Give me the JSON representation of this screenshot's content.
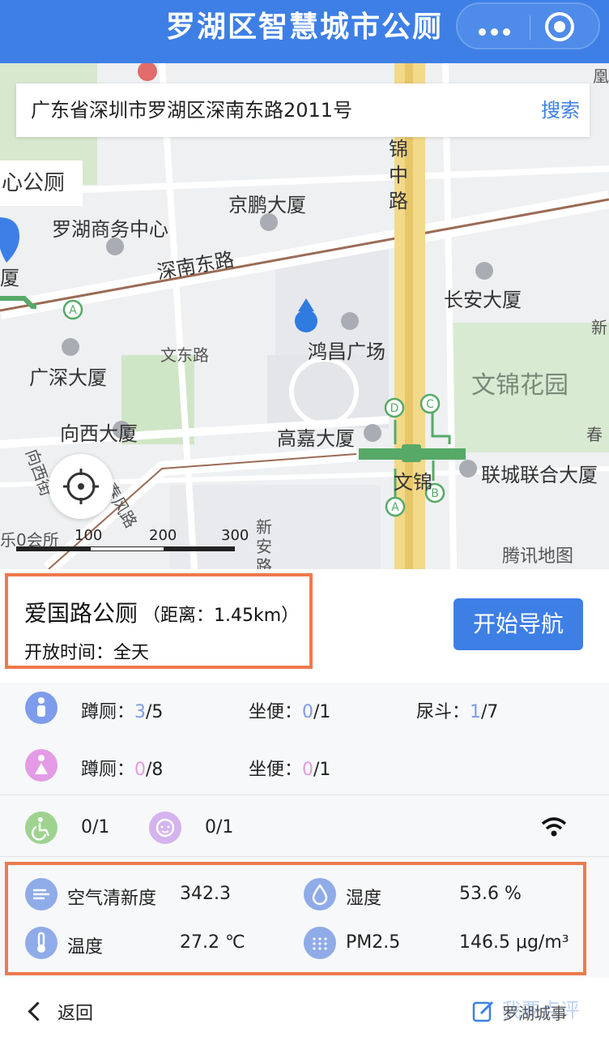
{
  "header": {
    "title": "罗湖区智慧城市公厕"
  },
  "search": {
    "address": "广东省深圳市罗湖区深南东路2011号",
    "button": "搜索"
  },
  "map": {
    "side_label": "心公厕",
    "labels": {
      "jinjin_road": "锦中路",
      "jingpeng": "京鹏大厦",
      "luohu_center": "罗湖商务中心",
      "shennan_road": "深南东路",
      "changan": "长安大厦",
      "hongchang": "鸿昌广场",
      "wendong_road": "文东路",
      "guangshen": "广深大厦",
      "wenjin_garden": "文锦花园",
      "xiangxi": "向西大厦",
      "gaojia": "高嘉大厦",
      "liancheng": "联城联合大厦",
      "wenjin_station": "文锦",
      "chunfeng_road": "春风路",
      "xiangxi_street": "向西街",
      "xin_an": "新安路",
      "toilet_short": "乐0会所",
      "xia": "厦",
      "huang": "凰",
      "xin": "新",
      "chun": "春"
    },
    "scale": [
      "100",
      "200",
      "300"
    ],
    "provider": "腾讯地图"
  },
  "toilet": {
    "name": "爱国路公厕",
    "distance": "（距离：1.45km）",
    "open_label": "开放时间：",
    "open_value": "全天",
    "nav_button": "开始导航"
  },
  "male": {
    "squat_label": "蹲厕：",
    "squat_used": "3",
    "squat_total": "/5",
    "seat_label": "坐便：",
    "seat_used": "0",
    "seat_total": "/1",
    "urinal_label": "尿斗：",
    "urinal_used": "1",
    "urinal_total": "/7"
  },
  "female": {
    "squat_label": "蹲厕：",
    "squat_used": "0",
    "squat_total": "/8",
    "seat_label": "坐便：",
    "seat_used": "0",
    "seat_total": "/1"
  },
  "special": {
    "accessible": "0/1",
    "baby": "0/1"
  },
  "environment": {
    "air_label": "空气清新度",
    "air_value": "342.3",
    "humidity_label": "湿度",
    "humidity_value": "53.6 %",
    "temp_label": "温度",
    "temp_value": "27.2 ℃",
    "pm_label": "PM2.5",
    "pm_value": "146.5 μg/m³"
  },
  "footer": {
    "back": "返回",
    "report": "我要点评",
    "watermark": "罗湖城事"
  },
  "colors": {
    "brand": "#3e7fe6",
    "highlight": "#ee7a4c",
    "male": "#7d9ceb",
    "female": "#e39be6"
  }
}
